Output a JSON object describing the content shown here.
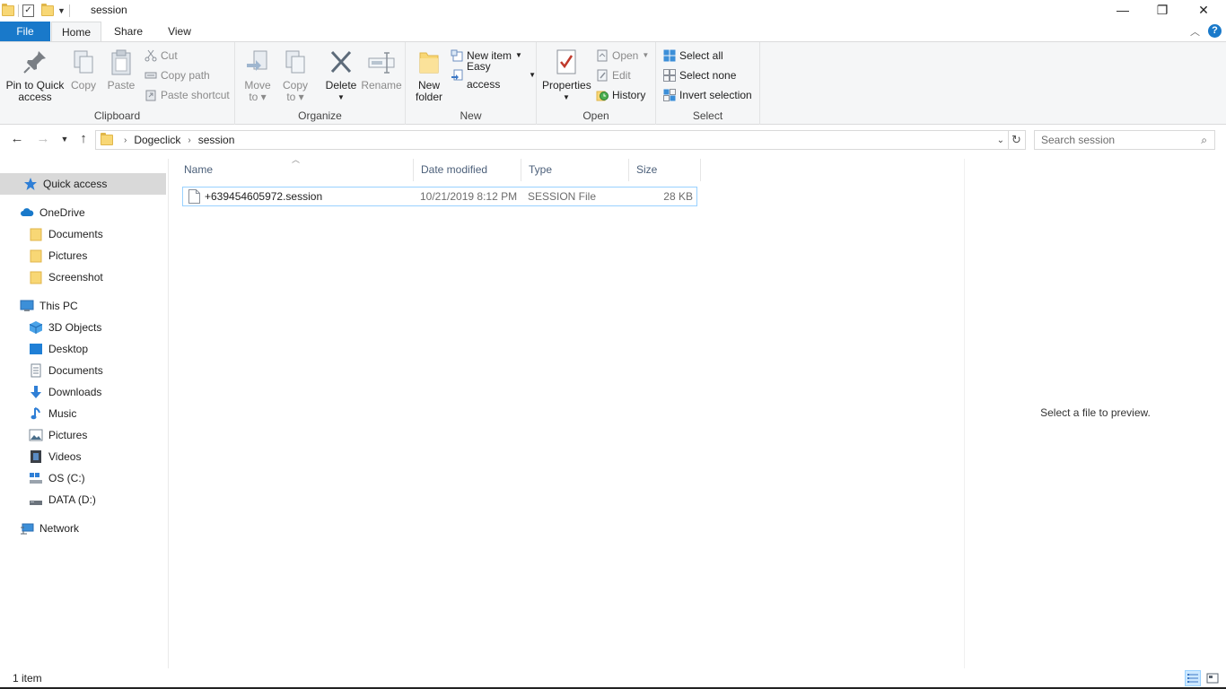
{
  "window": {
    "title": "session",
    "minimize_glyph": "—",
    "restore_glyph": "❐",
    "close_glyph": "✕"
  },
  "ribbon_tabs": {
    "file": "File",
    "home": "Home",
    "share": "Share",
    "view": "View"
  },
  "ribbon": {
    "clipboard": {
      "label": "Clipboard",
      "pin": "Pin to Quick access",
      "pin_line1": "Pin to Quick",
      "pin_line2": "access",
      "copy": "Copy",
      "paste": "Paste",
      "cut": "Cut",
      "copy_path": "Copy path",
      "paste_shortcut": "Paste shortcut"
    },
    "organize": {
      "label": "Organize",
      "move_to_line1": "Move",
      "move_to_line2": "to",
      "copy_to_line1": "Copy",
      "copy_to_line2": "to",
      "delete": "Delete",
      "rename": "Rename"
    },
    "new": {
      "label": "New",
      "new_folder_line1": "New",
      "new_folder_line2": "folder",
      "new_item": "New item",
      "easy_access": "Easy access"
    },
    "open": {
      "label": "Open",
      "properties": "Properties",
      "open": "Open",
      "edit": "Edit",
      "history": "History"
    },
    "select": {
      "label": "Select",
      "select_all": "Select all",
      "select_none": "Select none",
      "invert_selection": "Invert selection"
    }
  },
  "address": {
    "crumbs": [
      "Dogeclick",
      "session"
    ],
    "search_placeholder": "Search session"
  },
  "nav_pane": {
    "quick_access": "Quick access",
    "onedrive": "OneDrive",
    "onedrive_items": [
      "Documents",
      "Pictures",
      "Screenshot"
    ],
    "this_pc": "This PC",
    "this_pc_items": [
      "3D Objects",
      "Desktop",
      "Documents",
      "Downloads",
      "Music",
      "Pictures",
      "Videos",
      "OS (C:)",
      "DATA (D:)"
    ],
    "network": "Network"
  },
  "file_list": {
    "columns": [
      "Name",
      "Date modified",
      "Type",
      "Size"
    ],
    "rows": [
      {
        "name": "+639454605972.session",
        "date_modified": "10/21/2019 8:12 PM",
        "type": "SESSION File",
        "size": "28 KB"
      }
    ]
  },
  "preview": {
    "message": "Select a file to preview."
  },
  "status": {
    "item_count": "1 item"
  },
  "colors": {
    "accent": "#1979ca",
    "selection_border": "#99d1ff",
    "folder": "#f8d775"
  }
}
